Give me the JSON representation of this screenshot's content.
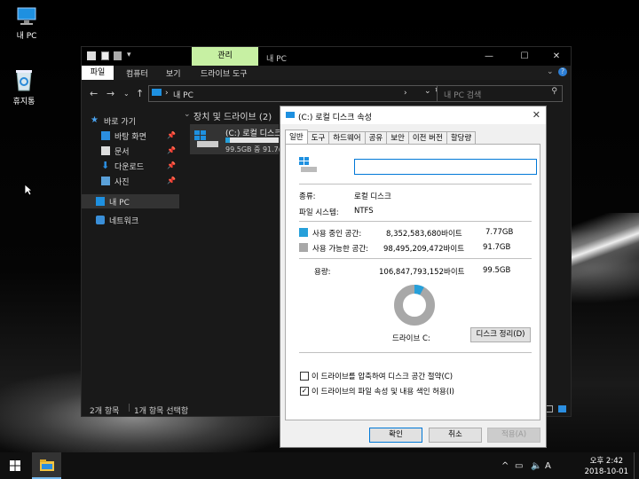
{
  "desktop": {
    "icons": [
      {
        "label": "내 PC",
        "icon": "pc-icon"
      },
      {
        "label": "휴지통",
        "icon": "recycle-bin-icon"
      }
    ]
  },
  "explorer": {
    "manage_tab": "관리",
    "title": "내 PC",
    "ribbon": {
      "file": "파일",
      "computer": "컴퓨터",
      "view": "보기",
      "drive_tools": "드라이브 도구"
    },
    "address": {
      "path_sep": "›",
      "location": "내 PC",
      "search_placeholder": "내 PC 검색"
    },
    "nav": {
      "quick_access": "바로 가기",
      "desktop": "바탕 화면",
      "documents": "문서",
      "downloads": "다운로드",
      "pictures": "사진",
      "this_pc": "내 PC",
      "network": "네트워크"
    },
    "content": {
      "group_header": "장치 및 드라이브 (2)",
      "drive_name": "(C:) 로컬 디스크",
      "drive_free": "99.5GB 중 91.7(",
      "drive_used_fraction": 0.08
    },
    "status": {
      "items": "2개 항목",
      "selected": "1개 항목 선택함"
    }
  },
  "dialog": {
    "title": "(C:) 로컬 디스크 속성",
    "tabs": [
      "일반",
      "도구",
      "하드웨어",
      "공유",
      "보안",
      "이전 버전",
      "할당량"
    ],
    "active_tab": "일반",
    "name_value": "",
    "type_label": "종류:",
    "type_value": "로컬 디스크",
    "fs_label": "파일 시스템:",
    "fs_value": "NTFS",
    "used_label": "사용 중인 공간:",
    "used_bytes": "8,352,583,680바이트",
    "used_gb": "7.77GB",
    "free_label": "사용 가능한 공간:",
    "free_bytes": "98,495,209,472바이트",
    "free_gb": "91.7GB",
    "cap_label": "용량:",
    "cap_bytes": "106,847,793,152바이트",
    "cap_gb": "99.5GB",
    "drive_label": "드라이브 C:",
    "cleanup_button": "디스크 정리(D)",
    "compress_label": "이 드라이브를 압축하여 디스크 공간 절약(C)",
    "compress_checked": false,
    "index_label": "이 드라이브의 파일 속성 및 내용 색인 허용(I)",
    "index_checked": true,
    "used_fraction": 0.078,
    "colors": {
      "used": "#26a0da",
      "free": "#a8a8a8"
    },
    "buttons": {
      "ok": "확인",
      "cancel": "취소",
      "apply": "적용(A)"
    }
  },
  "taskbar": {
    "tray_chevron": "^",
    "ime": "A",
    "time": "오후 2:42",
    "date": "2018-10-01"
  }
}
